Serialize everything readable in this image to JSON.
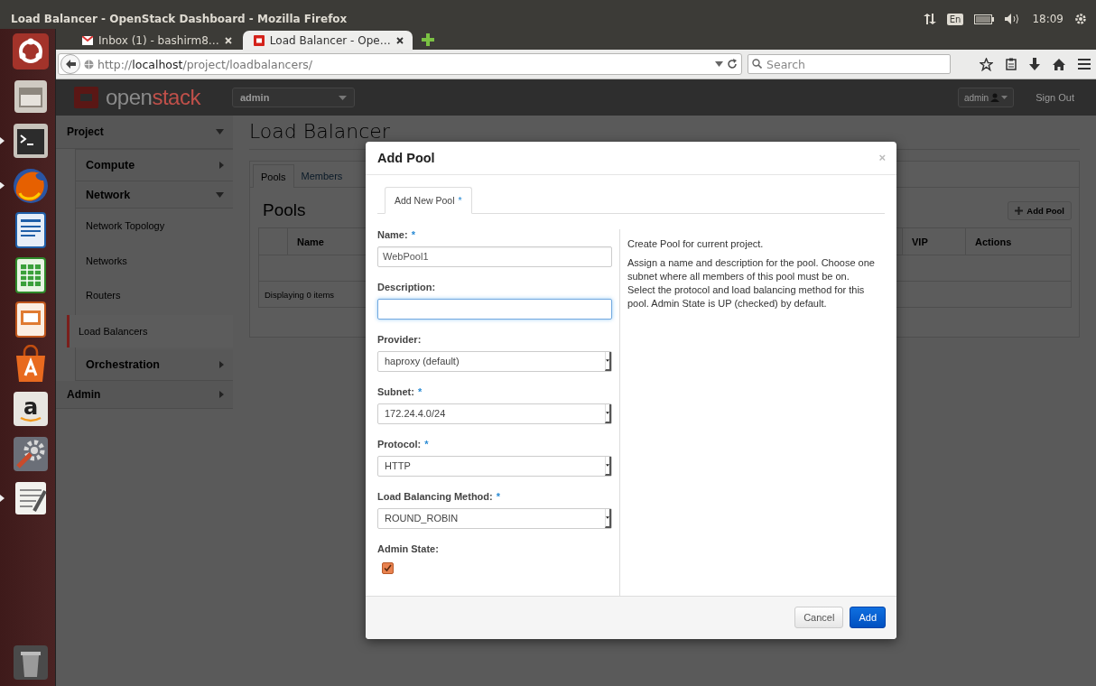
{
  "window": {
    "title": "Load Balancer - OpenStack Dashboard - Mozilla Firefox"
  },
  "system_tray": {
    "keyboard": "En",
    "clock": "18:09"
  },
  "launcher": [
    {
      "kind": "ubuntu",
      "running": false
    },
    {
      "kind": "files",
      "running": false
    },
    {
      "kind": "terminal",
      "running": true
    },
    {
      "kind": "firefox",
      "running": true
    },
    {
      "kind": "writer",
      "running": false
    },
    {
      "kind": "calc",
      "running": false
    },
    {
      "kind": "impress",
      "running": false
    },
    {
      "kind": "software",
      "running": false
    },
    {
      "kind": "amazon",
      "running": false,
      "glyph": "a"
    },
    {
      "kind": "settings",
      "running": false
    },
    {
      "kind": "editor",
      "running": true
    },
    {
      "kind": "trash",
      "running": false
    }
  ],
  "browser": {
    "tabs": [
      {
        "label": "Inbox (1) - bashirm8…",
        "selected": false,
        "kind": "mail"
      },
      {
        "label": "Load Balancer - Ope…",
        "selected": true,
        "kind": "openstack"
      }
    ],
    "url": {
      "scheme": "http://",
      "host": "localhost",
      "path": "/project/loadbalancers/"
    },
    "search": {
      "placeholder": "Search"
    }
  },
  "dashboard": {
    "logo": {
      "light": "open",
      "accent": "stack"
    },
    "project_select": "admin",
    "user_menu": "admin",
    "sign_out": "Sign Out"
  },
  "sidebar": [
    {
      "label": "Project",
      "expanded": true,
      "children": [
        {
          "label": "Compute",
          "expanded": false
        },
        {
          "label": "Network",
          "expanded": true,
          "children": [
            {
              "label": "Network Topology",
              "selected": false
            },
            {
              "label": "Networks",
              "selected": false
            },
            {
              "label": "Routers",
              "selected": false
            },
            {
              "label": "Load Balancers",
              "selected": true
            }
          ]
        },
        {
          "label": "Orchestration",
          "expanded": false
        }
      ]
    },
    {
      "label": "Admin",
      "expanded": false
    }
  ],
  "page": {
    "title": "Load Balancer",
    "tabs": [
      {
        "label": "Pools",
        "selected": true
      },
      {
        "label": "Members",
        "selected": false
      }
    ],
    "section_title": "Pools",
    "add_button": "Add Pool",
    "table": {
      "columns": [
        "Name",
        "VIP",
        "Actions"
      ],
      "footer": "Displaying 0 items"
    }
  },
  "modal": {
    "title": "Add Pool",
    "close": "×",
    "tab": {
      "label": "Add New Pool",
      "required_mark": "*",
      "selected": true
    },
    "fields": [
      {
        "kind": "text",
        "label": "Name:",
        "required_mark": "*",
        "value": "WebPool1",
        "focused": false
      },
      {
        "kind": "text",
        "label": "Description:",
        "focused": true
      },
      {
        "kind": "select",
        "label": "Provider:",
        "value": "haproxy (default)"
      },
      {
        "kind": "select",
        "label": "Subnet:",
        "required_mark": "*",
        "value": "172.24.4.0/24"
      },
      {
        "kind": "select",
        "label": "Protocol:",
        "required_mark": "*",
        "value": "HTTP"
      },
      {
        "kind": "select",
        "label": "Load Balancing Method:",
        "required_mark": "*",
        "value": "ROUND_ROBIN"
      },
      {
        "kind": "checkbox",
        "label": "Admin State:",
        "checked": true
      }
    ],
    "help": [
      "Create Pool for current project.",
      "Assign a name and description for the pool. Choose one subnet where all members of this pool must be on. Select the protocol and load balancing method for this pool. Admin State is UP (checked) by default."
    ],
    "buttons": [
      {
        "label": "Cancel",
        "kind": "default"
      },
      {
        "label": "Add",
        "kind": "primary"
      }
    ]
  }
}
